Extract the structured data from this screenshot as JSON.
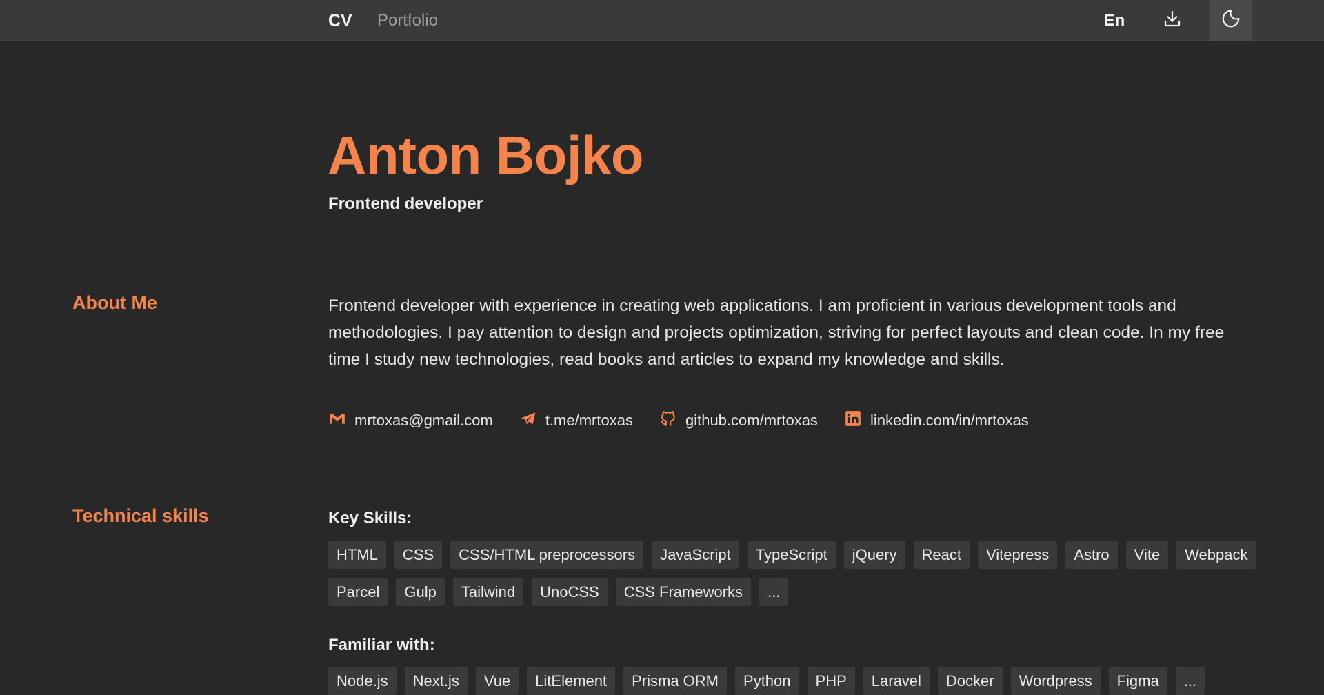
{
  "nav": {
    "cv": "CV",
    "portfolio": "Portfolio",
    "language": "En",
    "download_icon": "download-icon",
    "theme_icon": "moon-icon"
  },
  "header": {
    "name": "Anton Bojko",
    "role": "Frontend developer"
  },
  "about": {
    "title": "About Me",
    "text": "Frontend developer with experience in creating web applications. I am proficient in various development tools and methodologies. I pay attention to design and projects optimization, striving for perfect layouts and clean code. In my free time I study new technologies, read books and articles to expand my knowledge and skills."
  },
  "contacts": [
    {
      "icon": "gmail-icon",
      "label": "mrtoxas@gmail.com"
    },
    {
      "icon": "telegram-icon",
      "label": "t.me/mrtoxas"
    },
    {
      "icon": "github-icon",
      "label": "github.com/mrtoxas"
    },
    {
      "icon": "linkedin-icon",
      "label": "linkedin.com/in/mrtoxas"
    }
  ],
  "skills": {
    "title": "Technical skills",
    "key_title": "Key Skills:",
    "key": [
      "HTML",
      "CSS",
      "CSS/HTML preprocessors",
      "JavaScript",
      "TypeScript",
      "jQuery",
      "React",
      "Vitepress",
      "Astro",
      "Vite",
      "Webpack",
      "Parcel",
      "Gulp",
      "Tailwind",
      "UnoCSS",
      "CSS Frameworks",
      "..."
    ],
    "familiar_title": "Familiar with:",
    "familiar": [
      "Node.js",
      "Next.js",
      "Vue",
      "LitElement",
      "Prisma ORM",
      "Python",
      "PHP",
      "Laravel",
      "Docker",
      "Wordpress",
      "Figma",
      "..."
    ]
  },
  "colors": {
    "accent": "#f5844c",
    "background": "#282828",
    "topbar": "#3a3a3a",
    "tag_bg": "#3a3a3a"
  }
}
